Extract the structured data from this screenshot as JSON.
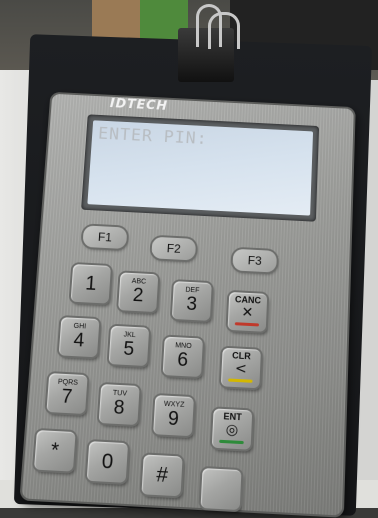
{
  "device": {
    "brand": "IDTECH",
    "display_text": "ENTER PIN:"
  },
  "function_keys": [
    "F1",
    "F2",
    "F3"
  ],
  "keys": [
    {
      "id": "1",
      "main": "1",
      "sub": ""
    },
    {
      "id": "2",
      "main": "2",
      "sub": "ABC"
    },
    {
      "id": "3",
      "main": "3",
      "sub": "DEF"
    },
    {
      "id": "4",
      "main": "4",
      "sub": "GHI"
    },
    {
      "id": "5",
      "main": "5",
      "sub": "JKL"
    },
    {
      "id": "6",
      "main": "6",
      "sub": "MNO"
    },
    {
      "id": "7",
      "main": "7",
      "sub": "PQRS"
    },
    {
      "id": "8",
      "main": "8",
      "sub": "TUV"
    },
    {
      "id": "9",
      "main": "9",
      "sub": "WXYZ"
    },
    {
      "id": "star",
      "main": "*",
      "sub": ""
    },
    {
      "id": "0",
      "main": "0",
      "sub": ""
    },
    {
      "id": "hash",
      "main": "#",
      "sub": ""
    }
  ],
  "action_keys": {
    "cancel": {
      "label": "CANC",
      "icon": "x-icon",
      "color": "#c0392b"
    },
    "clear": {
      "label": "CLR",
      "icon": "back-arrow-icon",
      "color": "#d4b800"
    },
    "enter": {
      "label": "ENT",
      "icon": "circle-icon",
      "color": "#2e8b3a"
    }
  }
}
